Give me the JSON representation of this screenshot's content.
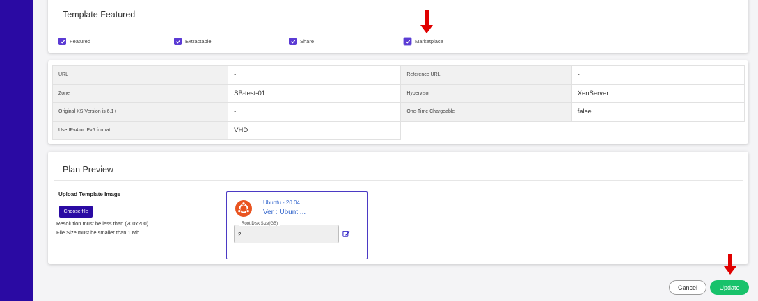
{
  "template_featured": {
    "title": "Template Featured",
    "checkboxes": [
      {
        "label": "Featured",
        "checked": true
      },
      {
        "label": "Extractable",
        "checked": true
      },
      {
        "label": "Share",
        "checked": true
      },
      {
        "label": "Marketplace",
        "checked": true
      }
    ]
  },
  "info_table": {
    "rows": [
      {
        "k1": "URL",
        "v1": "-",
        "k2": "Reference URL",
        "v2": "-"
      },
      {
        "k1": "Zone",
        "v1": "SB-test-01",
        "k2": "Hypervisor",
        "v2": "XenServer"
      },
      {
        "k1": "Original XS Version is 6.1+",
        "v1": "-",
        "k2": "One-Time Chargeable",
        "v2": "false"
      },
      {
        "k1": "Use IPv4 or IPv6 format",
        "v1": "VHD"
      }
    ]
  },
  "plan_preview": {
    "title": "Plan Preview",
    "upload_label": "Upload Template Image",
    "choose_file": "Choose file",
    "note_resolution": "Resolution must be less than (200x200)",
    "note_size": "File Size must be smaller than 1 Mb",
    "template_card": {
      "name": "Ubuntu - 20.04...",
      "version": "Ver : Ubunt ...",
      "disk_label": "Root Disk Size(GB)",
      "disk_value": "2",
      "logo_icon": "ubuntu-logo-icon",
      "edit_icon": "edit-icon"
    }
  },
  "actions": {
    "cancel": "Cancel",
    "update": "Update"
  },
  "colors": {
    "sidebar": "#2a0aa3",
    "checkbox": "#5b3bd4",
    "update": "#18c26b",
    "annotation_arrow": "#e00000"
  }
}
